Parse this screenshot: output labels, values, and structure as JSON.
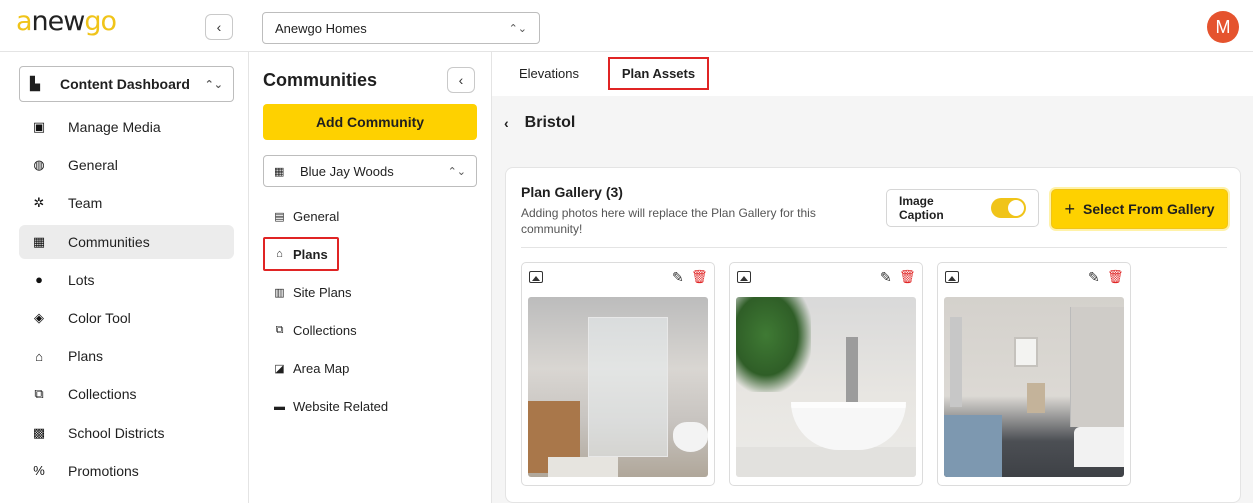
{
  "logo": {
    "part_a": "a",
    "part_b": "new",
    "part_c": "go"
  },
  "topbar": {
    "collapse_icon": "‹",
    "builder_select": "Anewgo Homes",
    "updown_icon": "⌃⌄",
    "avatar_letter": "M"
  },
  "sidebar": {
    "dashboard_select": "Content Dashboard",
    "items": [
      {
        "label": "Manage Media",
        "icon": "media-icon",
        "glyph": "▣"
      },
      {
        "label": "General",
        "icon": "globe-icon",
        "glyph": "◍"
      },
      {
        "label": "Team",
        "icon": "team-icon",
        "glyph": "✲"
      },
      {
        "label": "Communities",
        "icon": "buildings-icon",
        "glyph": "▦"
      },
      {
        "label": "Lots",
        "icon": "map-pin-icon",
        "glyph": "●"
      },
      {
        "label": "Color Tool",
        "icon": "paint-bucket-icon",
        "glyph": "◈"
      },
      {
        "label": "Plans",
        "icon": "home-icon",
        "glyph": "⌂"
      },
      {
        "label": "Collections",
        "icon": "collections-icon",
        "glyph": "⧉"
      },
      {
        "label": "School Districts",
        "icon": "school-icon",
        "glyph": "▩"
      },
      {
        "label": "Promotions",
        "icon": "percent-icon",
        "glyph": "%"
      }
    ]
  },
  "communities": {
    "title": "Communities",
    "add_button": "Add Community",
    "selected_community": "Blue Jay Woods",
    "items": [
      {
        "label": "General",
        "icon": "list-icon",
        "glyph": "▤"
      },
      {
        "label": "Plans",
        "icon": "home-icon",
        "glyph": "⌂"
      },
      {
        "label": "Site Plans",
        "icon": "map-icon",
        "glyph": "▥"
      },
      {
        "label": "Collections",
        "icon": "collections-icon",
        "glyph": "⧉"
      },
      {
        "label": "Area Map",
        "icon": "area-map-icon",
        "glyph": "◪"
      },
      {
        "label": "Website Related",
        "icon": "window-icon",
        "glyph": "▬"
      }
    ]
  },
  "main": {
    "tabs": [
      {
        "label": "Elevations"
      },
      {
        "label": "Plan Assets"
      }
    ],
    "back_icon": "‹",
    "breadcrumb": "Bristol",
    "gallery": {
      "title": "Plan Gallery (3)",
      "description": "Adding photos here will replace the Plan Gallery for this community!",
      "caption_label": "Image Caption",
      "caption_on": true,
      "select_button": "Select From Gallery",
      "plus_icon": "+",
      "edit_icon": "✎",
      "trash_icon": "🗑",
      "images": [
        {
          "alt": "bathroom-shower"
        },
        {
          "alt": "bathroom-vessel-sink"
        },
        {
          "alt": "bathroom-vanity-tub"
        }
      ]
    }
  },
  "colors": {
    "accent": "#fed100",
    "highlight": "#e02424",
    "avatar": "#e5532e"
  }
}
